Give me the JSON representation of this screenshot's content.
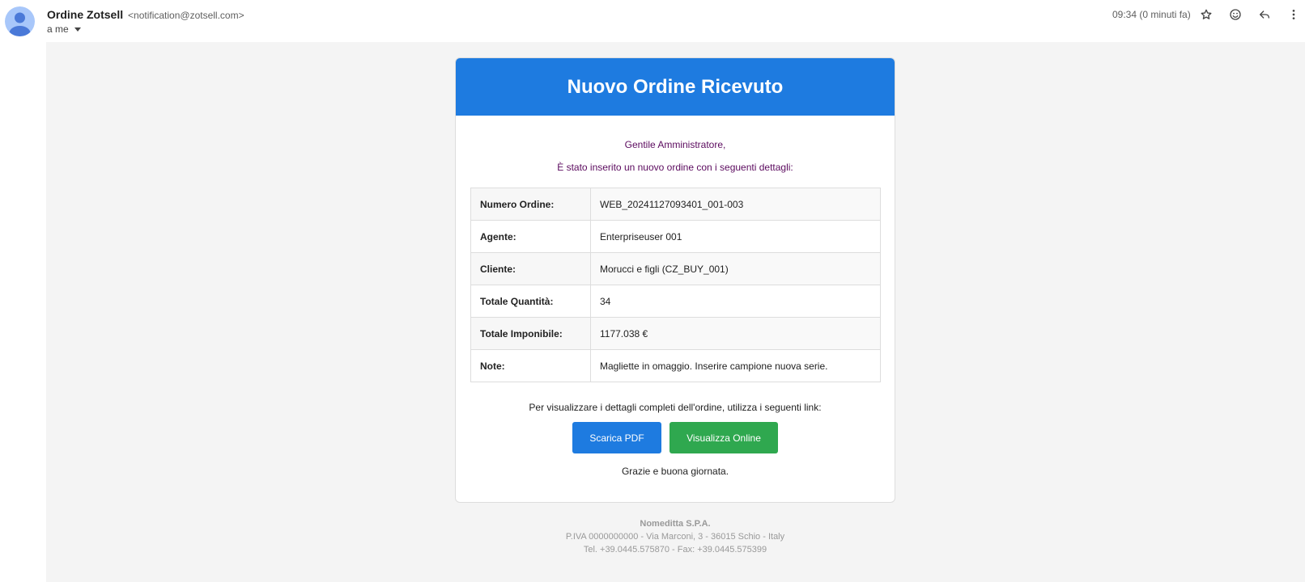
{
  "header": {
    "sender_name": "Ordine Zotsell",
    "sender_email": "<notification@zotsell.com>",
    "recipient": "a me",
    "timestamp": "09:34 (0 minuti fa)",
    "icons": [
      "star-icon",
      "emoji-icon",
      "reply-icon",
      "more-vert-icon"
    ]
  },
  "email": {
    "title": "Nuovo Ordine Ricevuto",
    "greeting": "Gentile Amministratore,",
    "intro": "È stato inserito un nuovo ordine con i seguenti dettagli:",
    "details": [
      {
        "label": "Numero Ordine:",
        "value": "WEB_20241127093401_001-003"
      },
      {
        "label": "Agente:",
        "value": "Enterpriseuser 001"
      },
      {
        "label": "Cliente:",
        "value": "Morucci e figli (CZ_BUY_001)"
      },
      {
        "label": "Totale Quantità:",
        "value": "34"
      },
      {
        "label": "Totale Imponibile:",
        "value": "1177.038 €"
      },
      {
        "label": "Note:",
        "value": "Magliette in omaggio. Inserire campione nuova serie."
      }
    ],
    "links_intro": "Per visualizzare i dettagli completi dell'ordine, utilizza i seguenti link:",
    "btn_pdf": "Scarica PDF",
    "btn_online": "Visualizza Online",
    "thanks": "Grazie e buona giornata."
  },
  "footer": {
    "company": "Nomeditta S.P.A.",
    "address": "P.IVA 0000000000 - Via Marconi, 3 - 36015 Schio - Italy",
    "contacts": "Tel. +39.0445.575870 - Fax: +39.0445.575399"
  },
  "colors": {
    "header_blue": "#1e7be0",
    "button_green": "#2fa84f",
    "greeting_purple": "#5b0a5e"
  }
}
